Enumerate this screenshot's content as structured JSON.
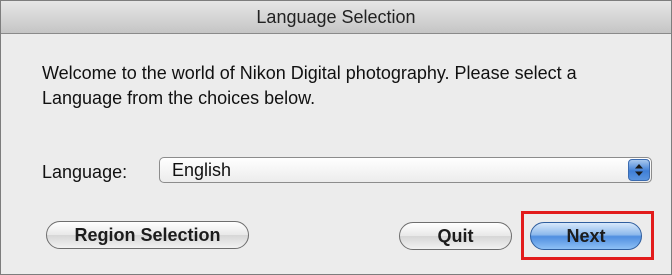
{
  "window": {
    "title": "Language Selection"
  },
  "message": "Welcome to the world of Nikon Digital photography. Please select a Language from the choices below.",
  "language": {
    "label": "Language:",
    "selected": "English"
  },
  "buttons": {
    "region": "Region Selection",
    "quit": "Quit",
    "next": "Next"
  },
  "colors": {
    "highlight": "#e21c1c",
    "default_button": "#4f8ee0"
  }
}
